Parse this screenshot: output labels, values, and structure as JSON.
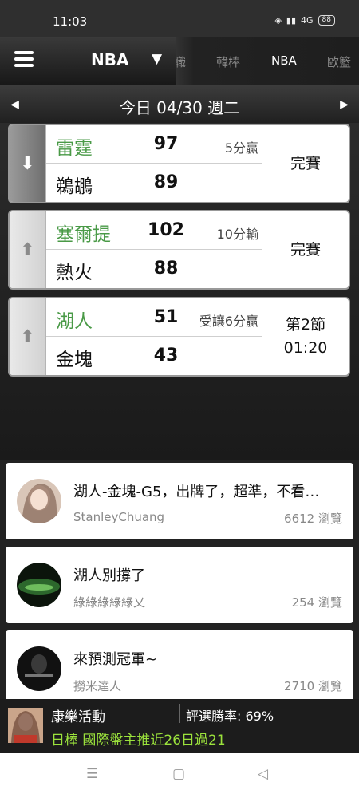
{
  "status_bar": {
    "time": "11:03",
    "signal_text": "4G",
    "battery": "88"
  },
  "header": {
    "league": "NBA",
    "tabs": [
      {
        "label": "職"
      },
      {
        "label": "韓棒"
      },
      {
        "label": "NBA"
      },
      {
        "label": "歐籃"
      }
    ]
  },
  "date_bar": {
    "label": "今日 04/30 週二"
  },
  "games": [
    {
      "team1": "雷霆",
      "score1": "97",
      "spread": "5分贏",
      "team2": "鵜鶘",
      "score2": "89",
      "status_line1": "完賽",
      "status_line2": ""
    },
    {
      "team1": "塞爾提",
      "score1": "102",
      "spread": "10分輸",
      "team2": "熱火",
      "score2": "88",
      "status_line1": "完賽",
      "status_line2": ""
    },
    {
      "team1": "湖人",
      "score1": "51",
      "spread": "受讓6分贏",
      "team2": "金塊",
      "score2": "43",
      "status_line1": "第2節",
      "status_line2": "01:20"
    }
  ],
  "posts": [
    {
      "title": "湖人-金塊-G5，出牌了，超準，不看…",
      "author": "StanleyChuang",
      "views": "6612 瀏覽"
    },
    {
      "title": "湖人別撐了",
      "author": "綠綠綠綠綠乂",
      "views": "254 瀏覽"
    },
    {
      "title": "來預測冠軍~",
      "author": "撈米達人",
      "views": "2710 瀏覽"
    }
  ],
  "promo": {
    "name": "康樂活動",
    "rate": "評選勝率: 69%",
    "text": "日棒 國際盤主推近26日過21"
  },
  "colors": {
    "win_green": "#4a9a47",
    "promo_green": "#9be23c",
    "header_dark": "#1e1e1e"
  }
}
